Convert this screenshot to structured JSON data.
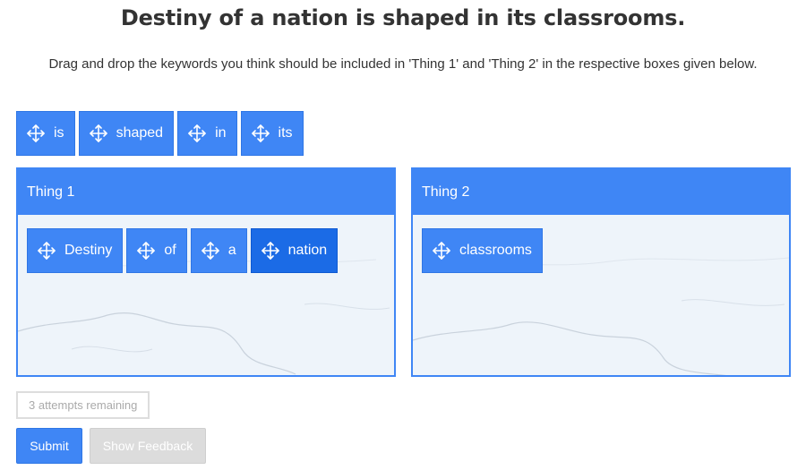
{
  "title": "Destiny of a nation is shaped in its classrooms.",
  "instructions": "Drag and drop the keywords you think should be included in 'Thing 1' and 'Thing 2' in the respective boxes given below.",
  "pool_words": [
    "is",
    "shaped",
    "in",
    "its"
  ],
  "zones": [
    {
      "label": "Thing 1",
      "words": [
        "Destiny",
        "of",
        "a",
        "nation"
      ]
    },
    {
      "label": "Thing 2",
      "words": [
        "classrooms"
      ]
    }
  ],
  "attempts_text": "3 attempts remaining",
  "buttons": {
    "submit": "Submit",
    "feedback": "Show Feedback"
  },
  "colors": {
    "accent": "#3f86f5",
    "accent_active": "#1b6be6",
    "zone_bg": "#eef4fa",
    "disabled": "#dcdcdc"
  },
  "icons": {
    "chip": "move-arrows-icon"
  }
}
